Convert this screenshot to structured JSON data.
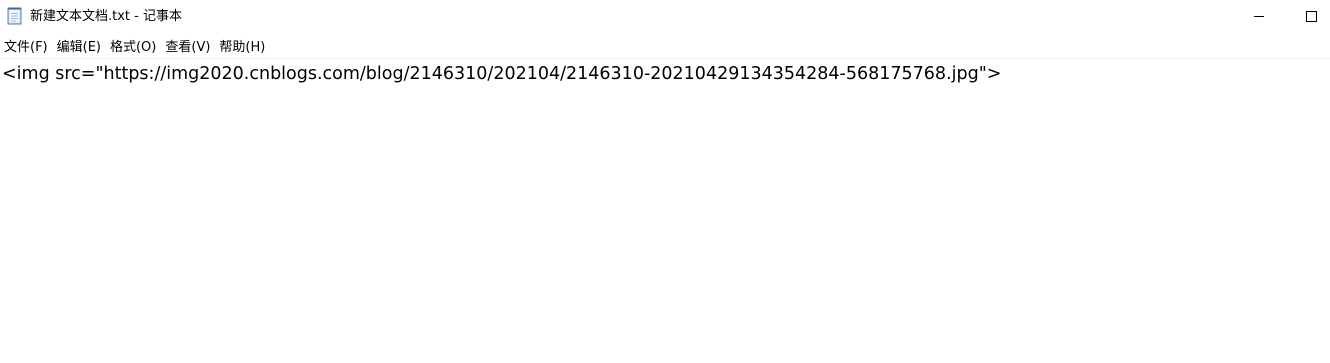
{
  "window": {
    "title": "新建文本文档.txt - 记事本",
    "icon": "notepad-icon",
    "controls": [
      "minimize-icon",
      "maximize-icon"
    ]
  },
  "menu": {
    "items": [
      {
        "label": "文件(F)"
      },
      {
        "label": "编辑(E)"
      },
      {
        "label": "格式(O)"
      },
      {
        "label": "查看(V)"
      },
      {
        "label": "帮助(H)"
      }
    ]
  },
  "editor": {
    "content": "<img src=\"https://img2020.cnblogs.com/blog/2146310/202104/2146310-20210429134354284-568175768.jpg\">"
  }
}
